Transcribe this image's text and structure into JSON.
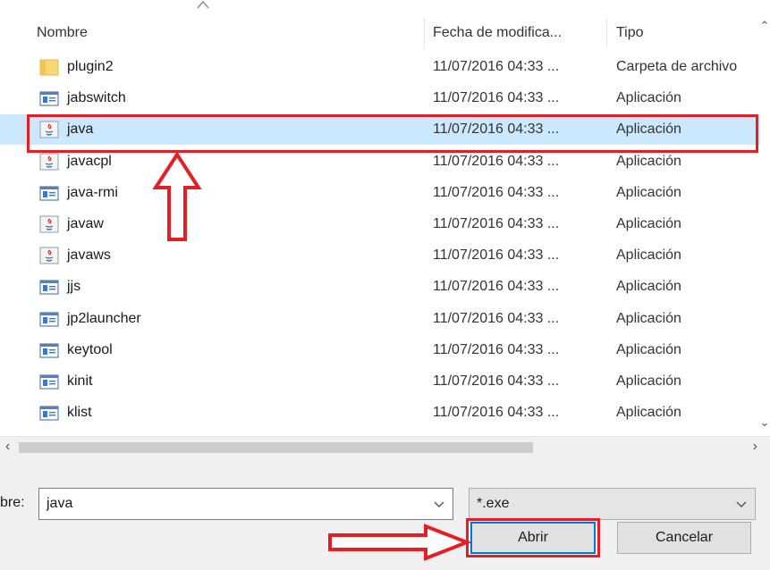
{
  "columns": {
    "name": "Nombre",
    "date": "Fecha de modifica...",
    "type": "Tipo"
  },
  "files": [
    {
      "name": "plugin2",
      "date": "11/07/2016 04:33 ...",
      "type": "Carpeta de archivo",
      "icon": "folder-icon"
    },
    {
      "name": "jabswitch",
      "date": "11/07/2016 04:33 ...",
      "type": "Aplicación",
      "icon": "app-icon"
    },
    {
      "name": "java",
      "date": "11/07/2016 04:33 ...",
      "type": "Aplicación",
      "icon": "java-icon"
    },
    {
      "name": "javacpl",
      "date": "11/07/2016 04:33 ...",
      "type": "Aplicación",
      "icon": "java-icon"
    },
    {
      "name": "java-rmi",
      "date": "11/07/2016 04:33 ...",
      "type": "Aplicación",
      "icon": "app-icon"
    },
    {
      "name": "javaw",
      "date": "11/07/2016 04:33 ...",
      "type": "Aplicación",
      "icon": "java-icon"
    },
    {
      "name": "javaws",
      "date": "11/07/2016 04:33 ...",
      "type": "Aplicación",
      "icon": "java-icon"
    },
    {
      "name": "jjs",
      "date": "11/07/2016 04:33 ...",
      "type": "Aplicación",
      "icon": "app-icon"
    },
    {
      "name": "jp2launcher",
      "date": "11/07/2016 04:33 ...",
      "type": "Aplicación",
      "icon": "app-icon"
    },
    {
      "name": "keytool",
      "date": "11/07/2016 04:33 ...",
      "type": "Aplicación",
      "icon": "app-icon"
    },
    {
      "name": "kinit",
      "date": "11/07/2016 04:33 ...",
      "type": "Aplicación",
      "icon": "app-icon"
    },
    {
      "name": "klist",
      "date": "11/07/2016 04:33 ...",
      "type": "Aplicación",
      "icon": "app-icon"
    }
  ],
  "bottom": {
    "filename_label": "bre:",
    "filename_value": "java",
    "filetype_value": "*.exe",
    "open_label": "Abrir",
    "cancel_label": "Cancelar"
  },
  "colors": {
    "selection": "#cce8ff",
    "annotation": "#e31e24",
    "focus": "#0078d7"
  }
}
